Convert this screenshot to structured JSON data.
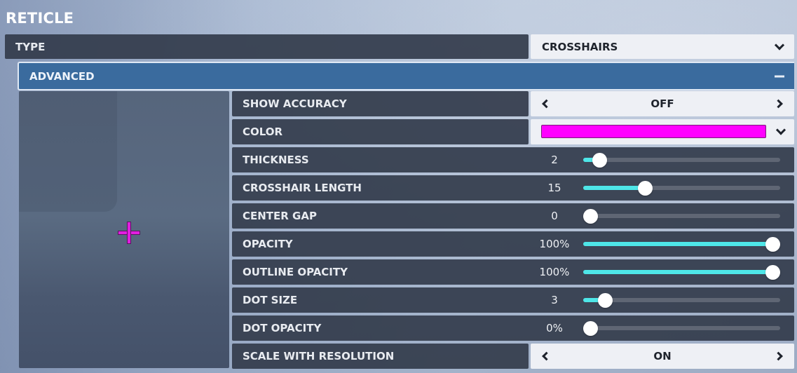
{
  "section_title": "RETICLE",
  "type_row": {
    "label": "TYPE",
    "value": "CROSSHAIRS",
    "control": "dropdown"
  },
  "advanced": {
    "label": "ADVANCED",
    "expanded": true,
    "toggle_icon": "minus-icon"
  },
  "preview": {
    "reticle_color": "#e21ee0",
    "reticle_shape": "crosshair"
  },
  "colors": {
    "accent_slider": "#4ee6e8",
    "advanced_bar": "#3a6b9e"
  },
  "settings": [
    {
      "id": "show-accuracy",
      "label": "SHOW ACCURACY",
      "control": "selector",
      "value": "OFF"
    },
    {
      "id": "color",
      "label": "COLOR",
      "control": "color-dropdown",
      "value": "#ff00ff"
    },
    {
      "id": "thickness",
      "label": "THICKNESS",
      "control": "slider",
      "value": "2",
      "fraction": 0.05
    },
    {
      "id": "crosshair-length",
      "label": "CROSSHAIR LENGTH",
      "control": "slider",
      "value": "15",
      "fraction": 0.3
    },
    {
      "id": "center-gap",
      "label": "CENTER GAP",
      "control": "slider",
      "value": "0",
      "fraction": 0.0
    },
    {
      "id": "opacity",
      "label": "OPACITY",
      "control": "slider",
      "value": "100%",
      "fraction": 1.0
    },
    {
      "id": "outline-opacity",
      "label": "OUTLINE OPACITY",
      "control": "slider",
      "value": "100%",
      "fraction": 1.0
    },
    {
      "id": "dot-size",
      "label": "DOT SIZE",
      "control": "slider",
      "value": "3",
      "fraction": 0.08
    },
    {
      "id": "dot-opacity",
      "label": "DOT OPACITY",
      "control": "slider",
      "value": "0%",
      "fraction": 0.0
    },
    {
      "id": "scale-with-resolution",
      "label": "SCALE WITH RESOLUTION",
      "control": "selector",
      "value": "ON"
    }
  ]
}
